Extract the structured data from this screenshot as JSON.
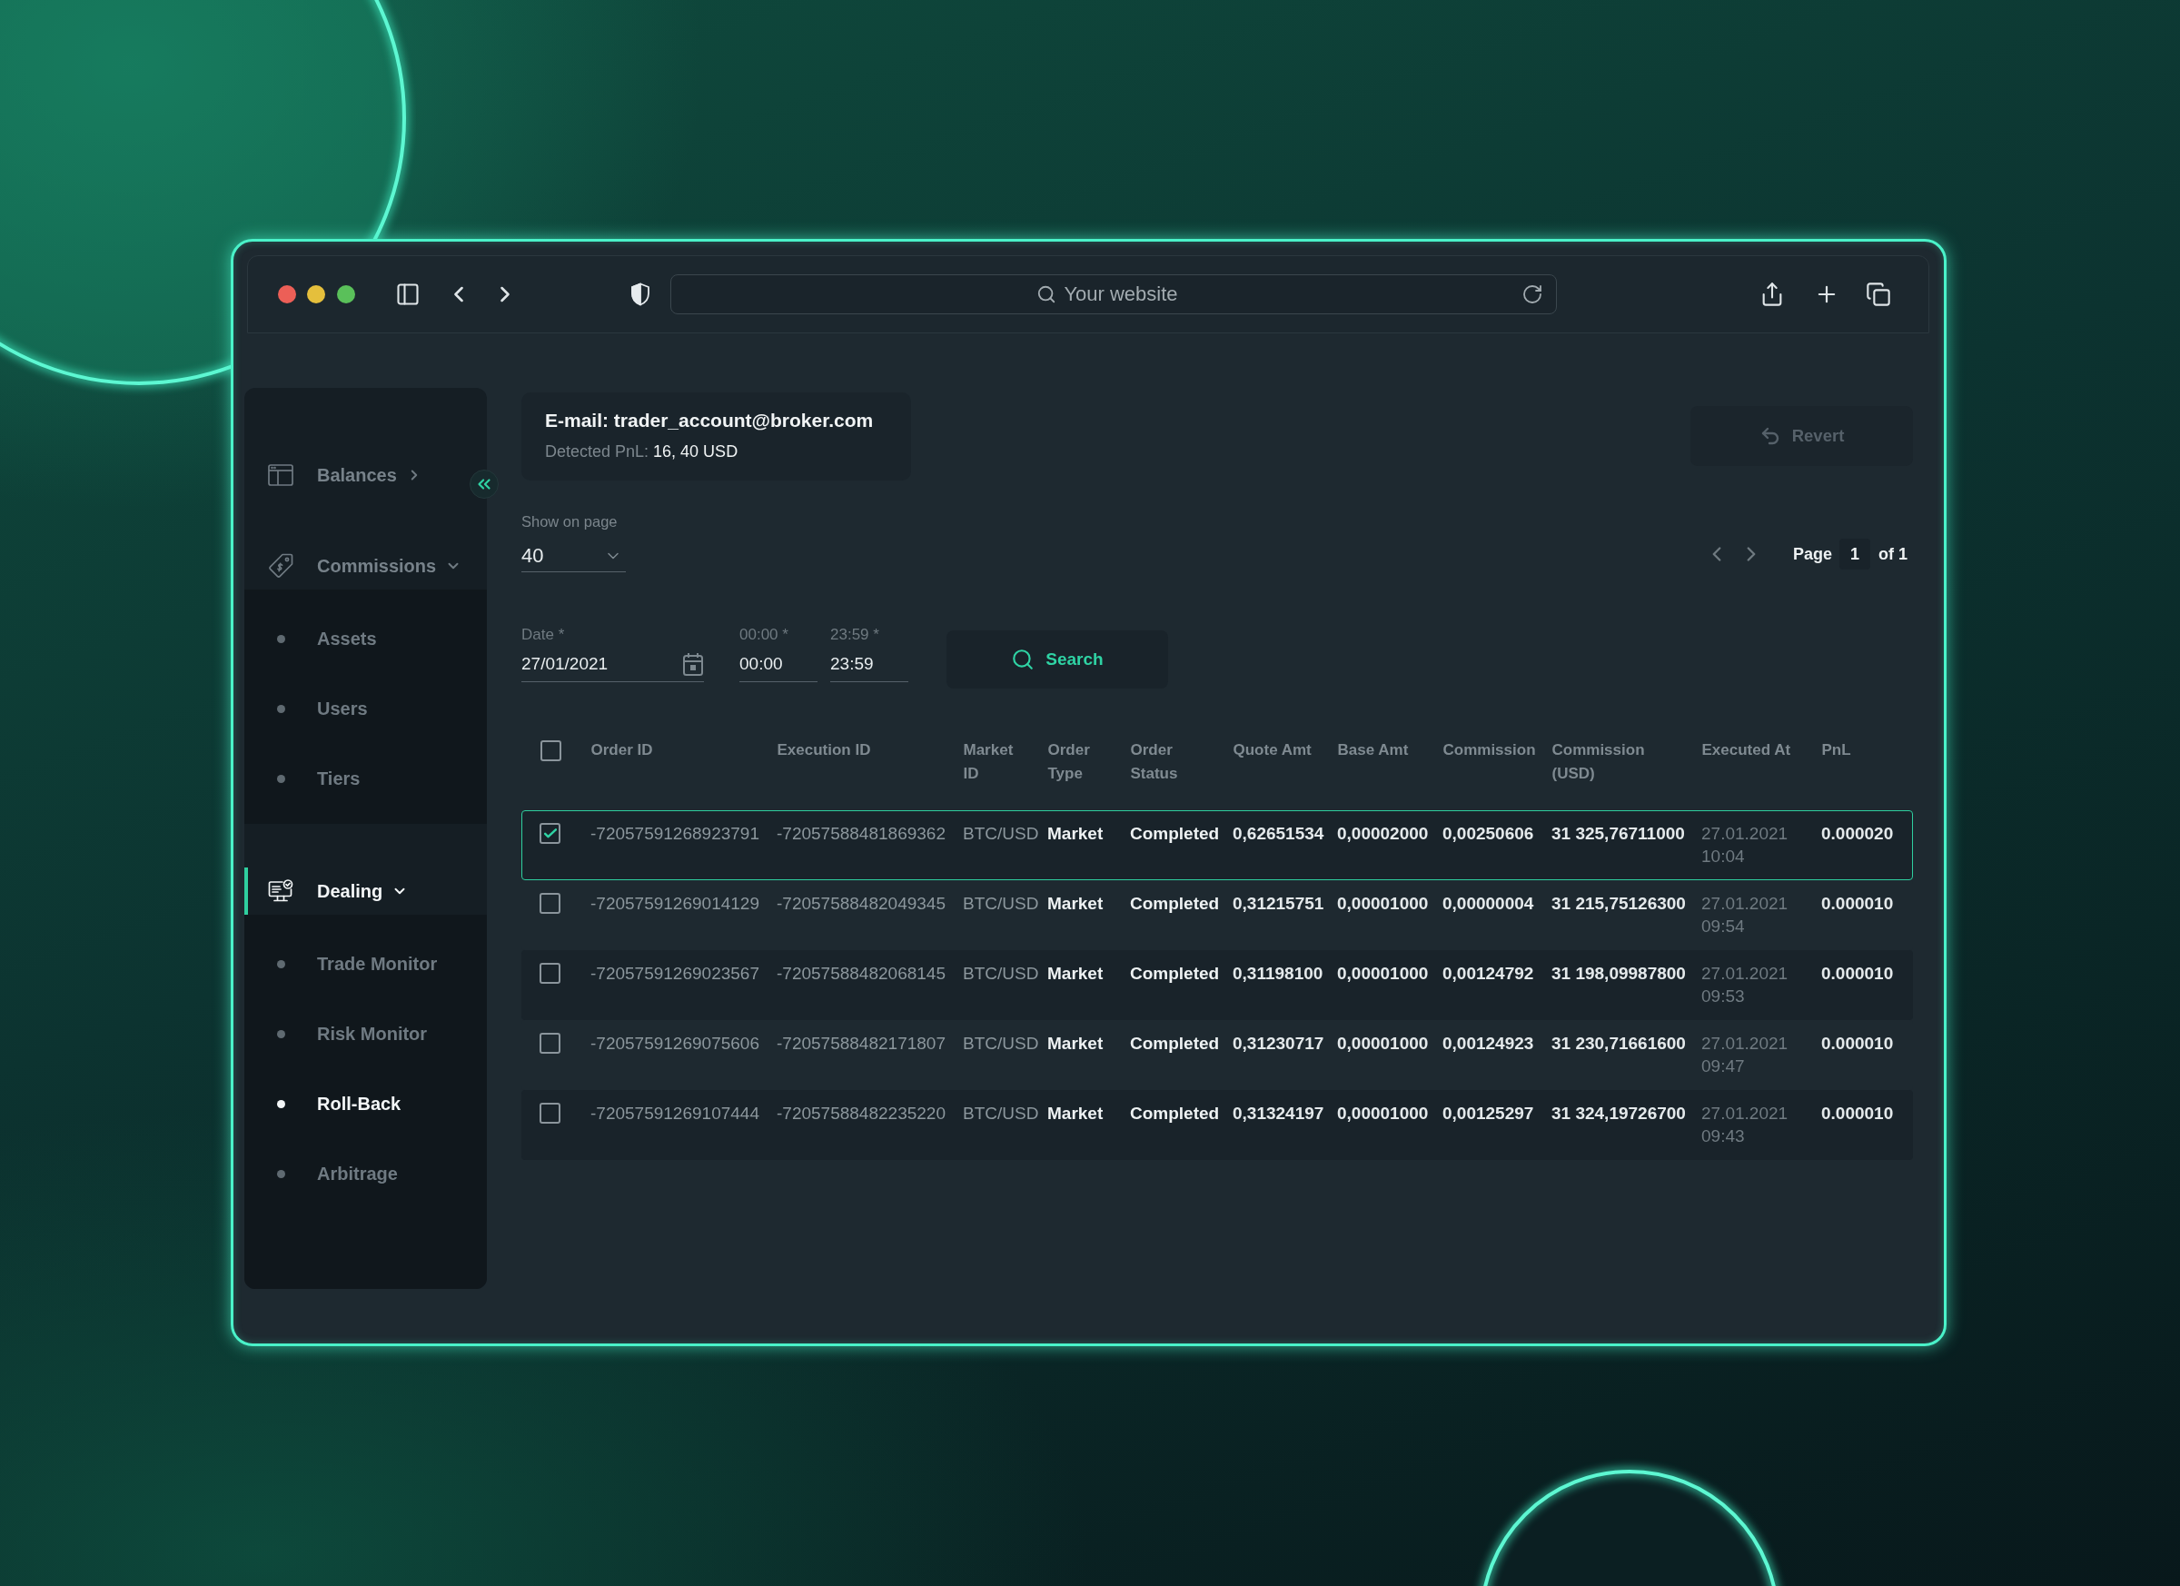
{
  "browser": {
    "placeholder": "Your website"
  },
  "sidebar": {
    "groups": [
      {
        "label": "Balances",
        "expanded": false,
        "selected": false
      },
      {
        "label": "Commissions",
        "expanded": true,
        "selected": false,
        "children": [
          {
            "label": "Assets",
            "selected": false
          },
          {
            "label": "Users",
            "selected": false
          },
          {
            "label": "Tiers",
            "selected": false
          }
        ]
      },
      {
        "label": "Dealing",
        "expanded": true,
        "selected": true,
        "children": [
          {
            "label": "Trade Monitor",
            "selected": false
          },
          {
            "label": "Risk Monitor",
            "selected": false
          },
          {
            "label": "Roll-Back",
            "selected": true
          },
          {
            "label": "Arbitrage",
            "selected": false
          }
        ]
      }
    ]
  },
  "account": {
    "email": "E-mail: trader_account@broker.com",
    "pnl_label": "Detected PnL:",
    "pnl_value": "16, 40 USD"
  },
  "revert_button": {
    "label": "Revert",
    "disabled": true
  },
  "page_size": {
    "label": "Show on page",
    "value": "40"
  },
  "pagination": {
    "label": "Page",
    "current": "1",
    "total": "of 1"
  },
  "filters": [
    {
      "kind": "date",
      "label": "Date *",
      "value": "27/01/2021"
    },
    {
      "kind": "time",
      "label": "00:00 *",
      "value": "00:00"
    },
    {
      "kind": "time",
      "label": "23:59 *",
      "value": "23:59"
    }
  ],
  "search_button": {
    "label": "Search"
  },
  "table": {
    "all_checked": false,
    "columns": [
      "Order ID",
      "Execution ID",
      "Market ID",
      "Order Type",
      "Order Status",
      "Quote Amt",
      "Base Amt",
      "Commission",
      "Commission (USD)",
      "Executed At",
      "PnL"
    ],
    "rows": [
      {
        "selected": true,
        "checked": true,
        "cells": [
          "-72057591268923791",
          "-72057588481869362",
          "BTC/USD",
          "Market",
          "Completed",
          "0,62651534",
          "0,00002000",
          "0,00250606",
          "31 325,76711000",
          "27.01.2021 10:04",
          "0.000020"
        ]
      },
      {
        "selected": false,
        "checked": false,
        "cells": [
          "-72057591269014129",
          "-72057588482049345",
          "BTC/USD",
          "Market",
          "Completed",
          "0,31215751",
          "0,00001000",
          "0,00000004",
          "31 215,75126300",
          "27.01.2021 09:54",
          "0.000010"
        ]
      },
      {
        "selected": false,
        "checked": false,
        "cells": [
          "-72057591269023567",
          "-72057588482068145",
          "BTC/USD",
          "Market",
          "Completed",
          "0,31198100",
          "0,00001000",
          "0,00124792",
          "31 198,09987800",
          "27.01.2021 09:53",
          "0.000010"
        ]
      },
      {
        "selected": false,
        "checked": false,
        "cells": [
          "-72057591269075606",
          "-72057588482171807",
          "BTC/USD",
          "Market",
          "Completed",
          "0,31230717",
          "0,00001000",
          "0,00124923",
          "31 230,71661600",
          "27.01.2021 09:47",
          "0.000010"
        ]
      },
      {
        "selected": false,
        "checked": false,
        "cells": [
          "-72057591269107444",
          "-72057588482235220",
          "BTC/USD",
          "Market",
          "Completed",
          "0,31324197",
          "0,00001000",
          "0,00125297",
          "31 324,19726700",
          "27.01.2021 09:43",
          "0.000010"
        ]
      }
    ]
  }
}
